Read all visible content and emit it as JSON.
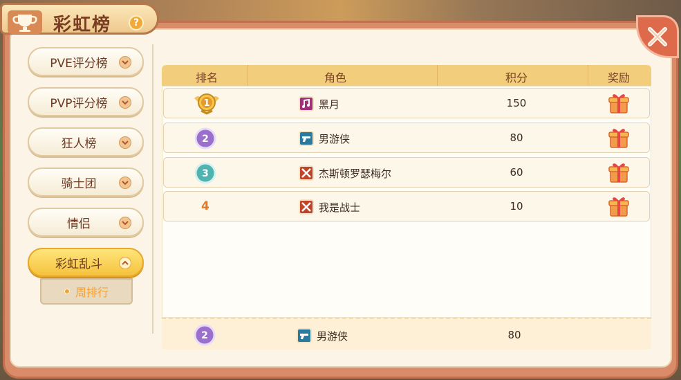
{
  "title": "彩虹榜",
  "help_icon": "?",
  "close_icon": "close-x",
  "sidebar": {
    "items": [
      {
        "label": "PVE评分榜",
        "active": false
      },
      {
        "label": "PVP评分榜",
        "active": false
      },
      {
        "label": "狂人榜",
        "active": false
      },
      {
        "label": "骑士团",
        "active": false
      },
      {
        "label": "情侣",
        "active": false
      },
      {
        "label": "彩虹乱斗",
        "active": true
      }
    ],
    "sub_items": [
      {
        "label": "周排行",
        "selected": true
      }
    ]
  },
  "table": {
    "headers": [
      "排名",
      "角色",
      "积分",
      "奖励"
    ],
    "rows": [
      {
        "rank": 1,
        "rank_style": "gold-medal",
        "role_icon": "music-note-icon",
        "role_color": "#a0307a",
        "name": "黑月",
        "score": "150",
        "reward_icon": "gift-box-icon"
      },
      {
        "rank": 2,
        "rank_style": "purple-badge",
        "role_icon": "gun-icon",
        "role_color": "#2a7aa0",
        "name": "男游侠",
        "score": "80",
        "reward_icon": "gift-box-icon"
      },
      {
        "rank": 3,
        "rank_style": "teal-badge",
        "role_icon": "swords-icon",
        "role_color": "#c0442a",
        "name": "杰斯顿罗瑟梅尔",
        "score": "60",
        "reward_icon": "gift-box-icon"
      },
      {
        "rank": 4,
        "rank_style": "plain",
        "rank_text": "4",
        "role_icon": "swords-icon",
        "role_color": "#c0442a",
        "name": "我是战士",
        "score": "10",
        "reward_icon": "gift-box-icon"
      }
    ],
    "self_row": {
      "rank": 2,
      "rank_style": "purple-badge",
      "role_icon": "gun-icon",
      "role_color": "#2a7aa0",
      "name": "男游侠",
      "score": "80"
    }
  },
  "colors": {
    "frame": "#d98b6a",
    "paper": "#fbf4e7",
    "header": "#f2cd7c",
    "active_tab": "#f5c23d",
    "accent_orange": "#f0a33c"
  }
}
